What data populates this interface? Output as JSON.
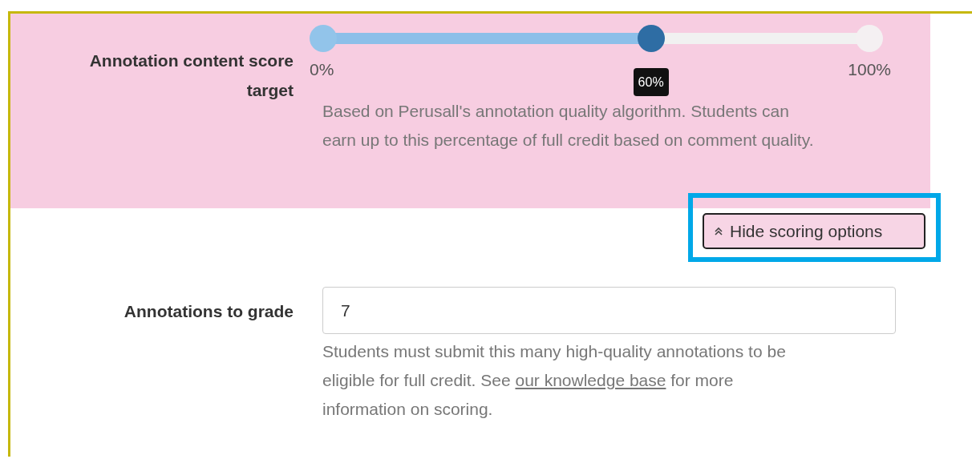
{
  "scoring": {
    "label": "Annotation content score target",
    "slider": {
      "level": 0.6,
      "min_label": "0%",
      "max_label": "100%",
      "value_label": "60%"
    },
    "help": "Based on Perusall's annotation quality algorithm. Students can earn up to this percentage of full credit based on comment quality."
  },
  "toggle_button": {
    "label": "Hide scoring options"
  },
  "annotations_to_grade": {
    "label": "Annotations to grade",
    "value": "7",
    "help_before": "Students must submit this many high-quality annotations to be eligible for full credit. See",
    "help_link": "our knowledge base",
    "help_after": "for more information on scoring."
  }
}
